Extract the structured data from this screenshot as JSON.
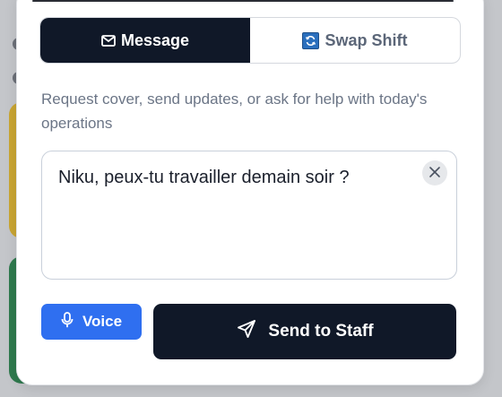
{
  "tabs": {
    "message_label": "Message",
    "swap_label": "Swap Shift",
    "active": "message"
  },
  "helper_text": "Request cover, send updates, or ask for help with today's operations",
  "message_input": {
    "value": "Niku, peux-tu travailler demain soir ?"
  },
  "actions": {
    "voice_label": "Voice",
    "send_label": "Send to Staff"
  },
  "icons": {
    "message": "mail-icon",
    "swap": "swap-icon",
    "clear": "close-icon",
    "voice": "microphone-icon",
    "send": "send-icon"
  },
  "colors": {
    "primary_dark": "#101828",
    "voice_blue": "#2f6ff0",
    "helper_text": "#6b7586"
  }
}
